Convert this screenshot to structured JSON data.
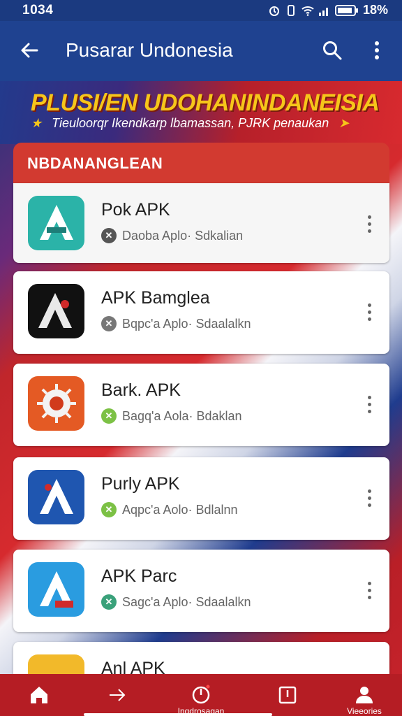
{
  "status_bar": {
    "time": "1034",
    "battery": "18%"
  },
  "app_bar": {
    "title": "Pusarar Undonesia",
    "icons": [
      "back-arrow-icon",
      "search-icon",
      "more-vert-icon"
    ]
  },
  "banner": {
    "title": "PLUSI/EN UDOHANINDANEISIA",
    "subtitle": "Tieuloorqr Ikendkarp lbamassan, PJRK penaukan"
  },
  "section": {
    "title": "NBDANANGLEAN"
  },
  "apps": [
    {
      "name": "Pok APK",
      "meta": "Daoba Aplo· Sdkalian",
      "icon": "pok-apk-app-icon",
      "icon_bg": "#2bb3a8",
      "icon_letter": "A",
      "badge_color": "#555555"
    },
    {
      "name": "APK Bamglea",
      "meta": "Bqpc'a Aplo· Sdaalalkn",
      "icon": "apk-bamglea-app-icon",
      "icon_bg": "#111111",
      "icon_letter": "A",
      "badge_color": "#777777"
    },
    {
      "name": "Bark. APK",
      "meta": "Bagq'a Aola· Bdaklan",
      "icon": "bark-apk-app-icon",
      "icon_bg": "#e45a24",
      "icon_letter": "●",
      "badge_color": "#7cc145"
    },
    {
      "name": "Purly APK",
      "meta": "Aqpc'a Aolo· Bdlalnn",
      "icon": "purly-apk-app-icon",
      "icon_bg": "#1f56b0",
      "icon_letter": "A",
      "badge_color": "#7cc145"
    },
    {
      "name": "APK Parc",
      "meta": "Sagc'a Aplo· Sdaalalkn",
      "icon": "apk-parc-app-icon",
      "icon_bg": "#2a9ce0",
      "icon_letter": "A",
      "badge_color": "#3aa17a"
    },
    {
      "name": "Anl APK",
      "meta": "",
      "icon": "anl-apk-app-icon",
      "icon_bg": "#f2b92a",
      "icon_letter": "",
      "badge_color": "#7cc145"
    }
  ],
  "bottom_nav": [
    {
      "label": "",
      "icon": "home-icon"
    },
    {
      "label": "",
      "icon": "arrow-right-icon"
    },
    {
      "label": "Inqdrosagan",
      "icon": "power-icon"
    },
    {
      "label": "",
      "icon": "square-icon"
    },
    {
      "label": "Vieeories",
      "icon": "profile-icon"
    }
  ],
  "colors": {
    "app_bar": "#1f4290",
    "section_header": "#d23a30",
    "bottom_nav": "#b51d24",
    "banner_title": "#f6c61a"
  }
}
